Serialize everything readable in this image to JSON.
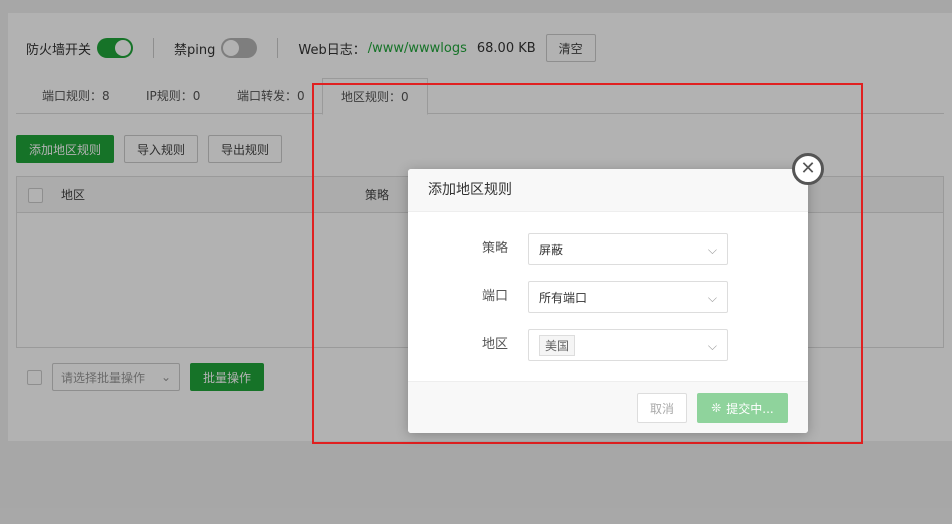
{
  "topbar": {
    "firewall_label": "防火墙开关",
    "ping_label": "禁ping",
    "weblog_label": "Web日志：",
    "weblog_path": "/www/wwwlogs",
    "weblog_size": "68.00 KB",
    "clear_label": "清空"
  },
  "tabs": [
    {
      "label": "端口规则：8"
    },
    {
      "label": "IP规则：0"
    },
    {
      "label": "端口转发：0"
    },
    {
      "label": "地区规则：0"
    }
  ],
  "actions": {
    "add_label": "添加地区规则",
    "import_label": "导入规则",
    "export_label": "导出规则"
  },
  "table": {
    "headers": [
      "地区",
      "策略"
    ]
  },
  "batch": {
    "select_placeholder": "请选择批量操作",
    "button_label": "批量操作"
  },
  "modal": {
    "title": "添加地区规则",
    "close_glyph": "✕",
    "fields": [
      {
        "label": "策略",
        "value": "屏蔽"
      },
      {
        "label": "端口",
        "value": "所有端口"
      },
      {
        "label": "地区",
        "value": "美国"
      }
    ],
    "cancel_label": "取消",
    "submit_label": "提交中..."
  },
  "colors": {
    "accent": "#20a53a",
    "highlight": "#e02020"
  }
}
